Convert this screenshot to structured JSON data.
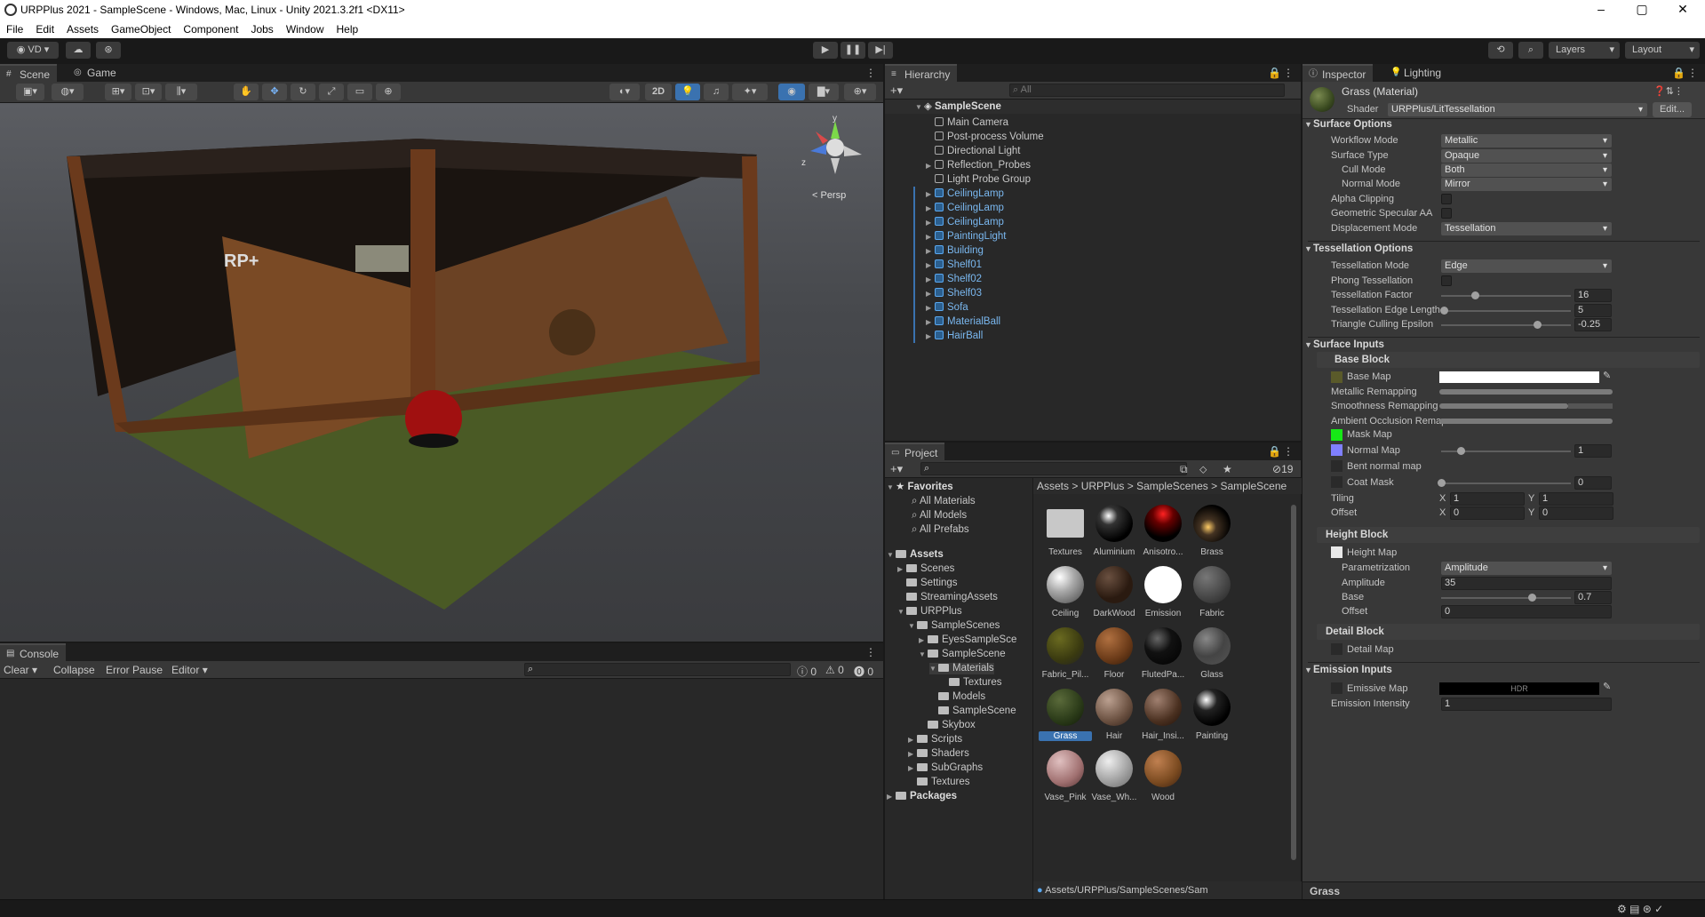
{
  "window": {
    "title": "URPPlus 2021 - SampleScene - Windows, Mac, Linux - Unity 2021.3.2f1 <DX11>"
  },
  "menu": [
    "File",
    "Edit",
    "Assets",
    "GameObject",
    "Component",
    "Jobs",
    "Window",
    "Help"
  ],
  "toolbar": {
    "account": "VD",
    "layers": "Layers",
    "layout": "Layout"
  },
  "scene": {
    "tab_scene": "Scene",
    "tab_game": "Game",
    "persp": "< Persp",
    "btn_2d": "2D",
    "gizmo_y": "y",
    "gizmo_z": "z"
  },
  "console": {
    "tab": "Console",
    "clear": "Clear",
    "collapse": "Collapse",
    "error_pause": "Error Pause",
    "editor": "Editor",
    "count_msg": "0",
    "count_warn": "0",
    "count_err": "0"
  },
  "hierarchy": {
    "tab": "Hierarchy",
    "search_placeholder": "All",
    "scene": "SampleScene",
    "items": [
      "Main Camera",
      "Post-process Volume",
      "Directional Light",
      "Reflection_Probes",
      "Light Probe Group",
      "CeilingLamp",
      "CeilingLamp",
      "CeilingLamp",
      "PaintingLight",
      "Building",
      "Shelf01",
      "Shelf02",
      "Shelf03",
      "Sofa",
      "MaterialBall",
      "HairBall"
    ]
  },
  "project": {
    "tab": "Project",
    "hidden_count": "19",
    "favorites": {
      "label": "Favorites",
      "items": [
        "All Materials",
        "All Models",
        "All Prefabs"
      ]
    },
    "tree": [
      "Assets",
      "Scenes",
      "Settings",
      "StreamingAssets",
      "URPPlus",
      "SampleScenes",
      "EyesSampleSce",
      "SampleScene",
      "Materials",
      "Textures",
      "Models",
      "SampleScene",
      "Skybox",
      "Scripts",
      "Shaders",
      "SubGraphs",
      "Textures",
      "Packages"
    ],
    "breadcrumb": [
      "Assets",
      "URPPlus",
      "SampleScenes",
      "SampleScene"
    ],
    "assets": [
      "Textures",
      "Aluminium",
      "Anisotro...",
      "Brass",
      "Ceiling",
      "DarkWood",
      "Emission",
      "Fabric",
      "Fabric_Pil...",
      "Floor",
      "FlutedPa...",
      "Glass",
      "Grass",
      "Hair",
      "Hair_Insi...",
      "Painting",
      "Vase_Pink",
      "Vase_Wh...",
      "Wood"
    ],
    "path": "Assets/URPPlus/SampleScenes/Sam"
  },
  "inspector": {
    "tab_inspector": "Inspector",
    "tab_lighting": "Lighting",
    "material": "Grass (Material)",
    "shader_label": "Shader",
    "shader": "URPPlus/LitTessellation",
    "edit": "Edit...",
    "surface_options": "Surface Options",
    "workflow_mode": "Workflow Mode",
    "workflow_mode_v": "Metallic",
    "surface_type": "Surface Type",
    "surface_type_v": "Opaque",
    "cull_mode": "Cull Mode",
    "cull_mode_v": "Both",
    "normal_mode": "Normal Mode",
    "normal_mode_v": "Mirror",
    "alpha_clipping": "Alpha Clipping",
    "geom_aa": "Geometric Specular AA",
    "displacement_mode": "Displacement Mode",
    "displacement_mode_v": "Tessellation",
    "tess_options": "Tessellation Options",
    "tess_mode": "Tessellation Mode",
    "tess_mode_v": "Edge",
    "phong": "Phong Tessellation",
    "tess_factor": "Tessellation Factor",
    "tess_factor_v": "16",
    "tess_edge": "Tessellation Edge Length",
    "tess_edge_v": "5",
    "tri_cull": "Triangle Culling Epsilon",
    "tri_cull_v": "-0.25",
    "surface_inputs": "Surface Inputs",
    "base_block": "Base Block",
    "base_map": "Base Map",
    "metallic_remap": "Metallic Remapping",
    "smooth_remap": "Smoothness Remapping",
    "ao_remap": "Ambient Occlusion Remap",
    "mask_map": "Mask Map",
    "normal_map": "Normal Map",
    "normal_map_v": "1",
    "bent_normal": "Bent normal map",
    "coat_mask": "Coat Mask",
    "coat_mask_v": "0",
    "tiling": "Tiling",
    "offset": "Offset",
    "x": "X",
    "y": "Y",
    "tiling_x": "1",
    "tiling_y": "1",
    "offset_x": "0",
    "offset_y": "0",
    "height_block": "Height Block",
    "height_map": "Height Map",
    "parametrization": "Parametrization",
    "parametrization_v": "Amplitude",
    "amplitude": "Amplitude",
    "amplitude_v": "35",
    "base": "Base",
    "base_v": "0.7",
    "h_offset": "Offset",
    "h_offset_v": "0",
    "detail_block": "Detail Block",
    "detail_map": "Detail Map",
    "emission_inputs": "Emission Inputs",
    "emissive_map": "Emissive Map",
    "hdr": "HDR",
    "emission_intensity": "Emission Intensity",
    "emission_intensity_v": "1",
    "footer": "Grass"
  },
  "colors": {
    "accent": "#3a72b0",
    "blue_text": "#5aa8f0",
    "mask_swatch": "#16e816",
    "normal_swatch": "#8080ff",
    "base_swatch": "#5a5a2a"
  }
}
